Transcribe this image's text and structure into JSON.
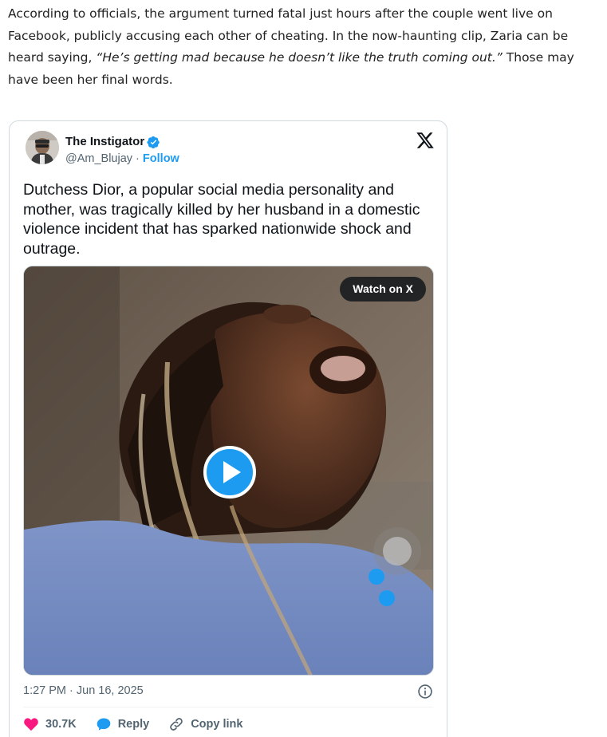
{
  "article": {
    "text_before": "According to officials, the argument turned fatal just hours after the couple went live on Facebook, publicly accusing each other of cheating. In the now-haunting clip, Zaria can be heard saying, ",
    "quote": "“He’s getting mad because he doesn’t like the truth coming out.”",
    "text_after": " Those may have been her final words."
  },
  "tweet": {
    "author_name": "The Instigator",
    "handle": "@Am_Blujay",
    "separator": " · ",
    "follow_label": "Follow",
    "text": "Dutchess Dior, a popular social media personality and mother, was tragically killed by her husband in a domestic violence incident that has sparked nationwide shock and outrage.",
    "watch_label": "Watch on X",
    "timestamp": "1:27 PM · Jun 16, 2025",
    "like_count": "30.7K",
    "reply_label": "Reply",
    "copy_link_label": "Copy link"
  },
  "icons": {
    "verified": "verified-badge-icon",
    "logo": "x-logo-icon",
    "play": "play-icon",
    "info": "info-icon",
    "like": "heart-icon",
    "reply": "reply-bubble-icon",
    "copy": "link-icon"
  },
  "colors": {
    "accent": "#1d9bf0",
    "like": "#f91880",
    "text": "#0f1419",
    "muted": "#536471"
  }
}
